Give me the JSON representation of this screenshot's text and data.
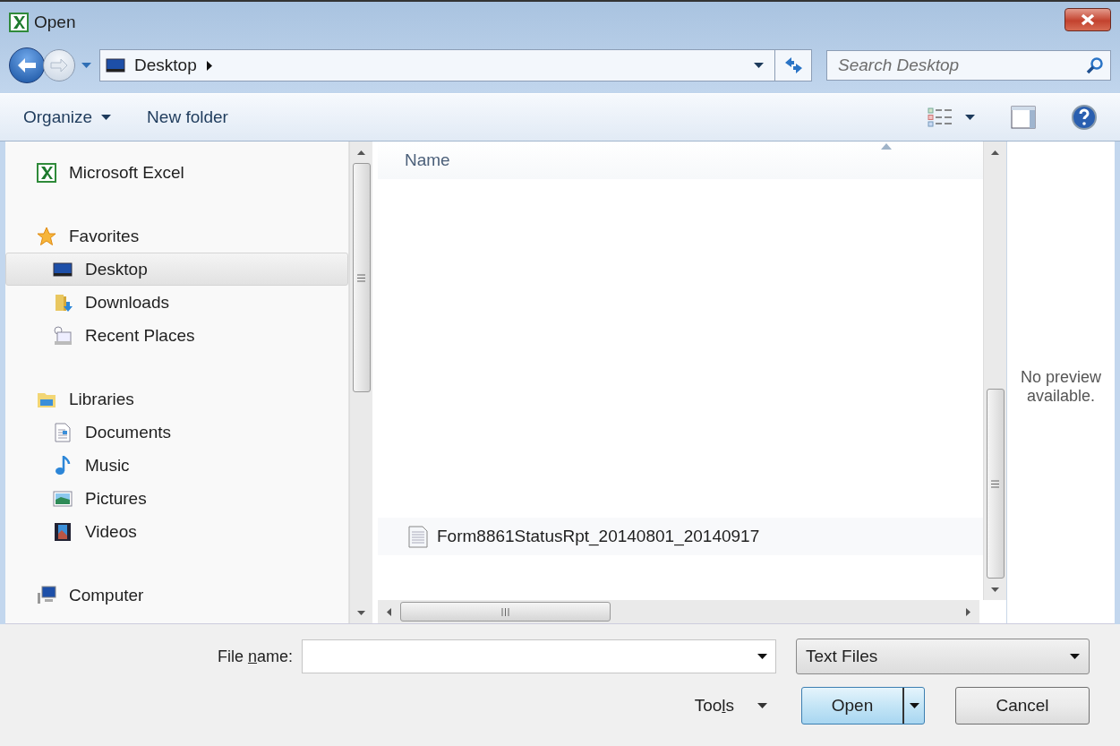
{
  "window": {
    "title": "Open"
  },
  "address": {
    "crumbs": [
      "Desktop"
    ]
  },
  "search": {
    "placeholder": "Search Desktop"
  },
  "toolbar": {
    "buttons": [
      {
        "label": "Organize",
        "dropdown": true
      },
      {
        "label": "New folder",
        "dropdown": false
      }
    ]
  },
  "sidebar": {
    "items": [
      {
        "label": "Microsoft Excel",
        "kind": "excel",
        "selected": false
      },
      {
        "label": "Favorites",
        "kind": "star",
        "selected": false,
        "children": [
          {
            "label": "Desktop",
            "kind": "desktop",
            "selected": true
          },
          {
            "label": "Downloads",
            "kind": "downloads",
            "selected": false
          },
          {
            "label": "Recent Places",
            "kind": "recent",
            "selected": false
          }
        ]
      },
      {
        "label": "Libraries",
        "kind": "libraries",
        "selected": false,
        "children": [
          {
            "label": "Documents",
            "kind": "documents",
            "selected": false
          },
          {
            "label": "Music",
            "kind": "music",
            "selected": false
          },
          {
            "label": "Pictures",
            "kind": "pictures",
            "selected": false
          },
          {
            "label": "Videos",
            "kind": "videos",
            "selected": false
          }
        ]
      },
      {
        "label": "Computer",
        "kind": "computer",
        "selected": false
      }
    ]
  },
  "file_list": {
    "columns": [
      "Name"
    ],
    "rows": [
      {
        "name": "Form8861StatusRpt_20140801_20140917"
      }
    ]
  },
  "preview": {
    "message": "No preview available."
  },
  "file_name": {
    "label_parts": [
      {
        "text": "File ",
        "underlined": false
      },
      {
        "text": "n",
        "underlined": true
      },
      {
        "text": "ame:",
        "underlined": false
      }
    ]
  },
  "file_type": {
    "value": "Text Files"
  },
  "tools": {
    "label_parts": [
      {
        "text": "Too",
        "underlined": false
      },
      {
        "text": "l",
        "underlined": true
      },
      {
        "text": "s",
        "underlined": false
      }
    ]
  },
  "buttons": [
    {
      "label": "Open",
      "kind": "split"
    },
    {
      "label": "Cancel",
      "kind": "plain"
    }
  ]
}
